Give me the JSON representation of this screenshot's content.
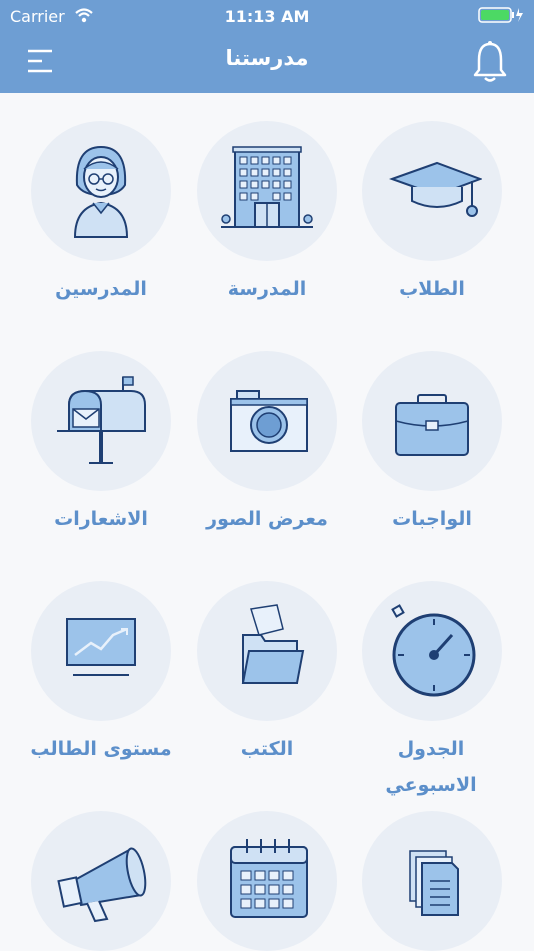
{
  "status_bar": {
    "carrier": "Carrier",
    "time": "11:13 AM"
  },
  "navbar": {
    "title": "مدرستنا",
    "menu_icon": "menu-icon",
    "notification_icon": "bell-icon"
  },
  "tiles": [
    {
      "label": "الطلاب",
      "icon": "graduation-cap-icon"
    },
    {
      "label": "المدرسة",
      "icon": "school-building-icon"
    },
    {
      "label": "المدرسين",
      "icon": "teacher-icon"
    },
    {
      "label": "الواجبات",
      "icon": "briefcase-icon"
    },
    {
      "label": "معرض الصور",
      "icon": "camera-icon"
    },
    {
      "label": "الاشعارات",
      "icon": "mailbox-icon"
    },
    {
      "label": "الجدول الاسبوعي",
      "icon": "stopwatch-icon"
    },
    {
      "label": "الكتب",
      "icon": "folder-icon"
    },
    {
      "label": "مستوى الطالب",
      "icon": "chart-monitor-icon"
    },
    {
      "label": "",
      "icon": "documents-icon"
    },
    {
      "label": "",
      "icon": "calendar-icon"
    },
    {
      "label": "",
      "icon": "megaphone-icon"
    }
  ],
  "colors": {
    "header": "#6e9ed3",
    "label": "#5c8fca",
    "circle": "#e9eef5",
    "icon_stroke": "#1f3f73",
    "icon_fill": "#9cc3ea"
  }
}
